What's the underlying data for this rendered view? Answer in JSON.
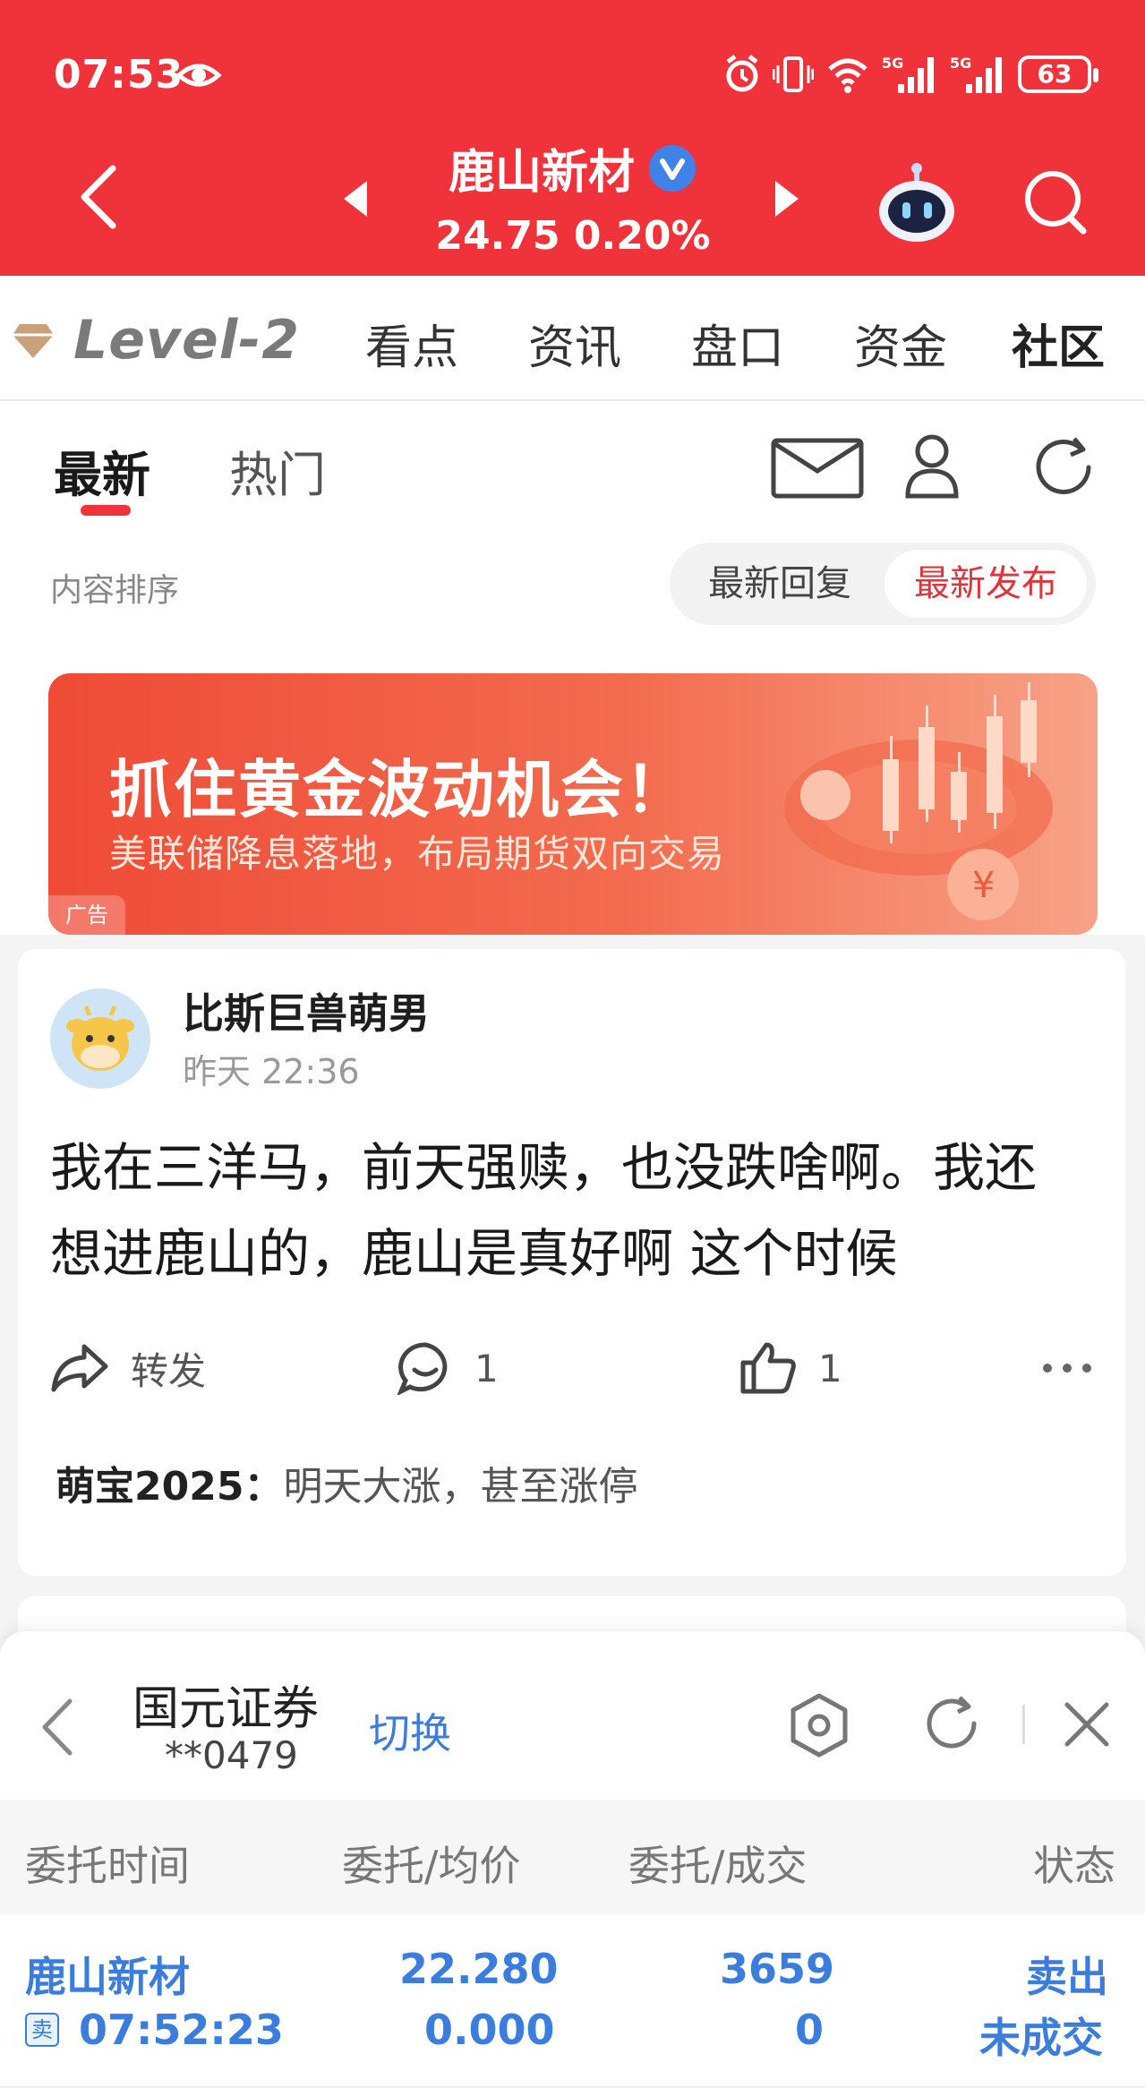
{
  "status_bar": {
    "time": "07:53",
    "battery": "63"
  },
  "header": {
    "stock_name": "鹿山新材",
    "quote": "24.75 0.20%"
  },
  "tabs": {
    "level2": "Level-2",
    "items": [
      "看点",
      "资讯",
      "盘口",
      "资金",
      "社区"
    ],
    "active": "社区"
  },
  "subtabs": {
    "items": [
      "最新",
      "热门"
    ],
    "active": "最新"
  },
  "sort": {
    "label": "内容排序",
    "options": [
      "最新回复",
      "最新发布"
    ],
    "selected": "最新发布"
  },
  "banner": {
    "title": "抓住黄金波动机会！",
    "subtitle": "美联储降息落地，布局期货双向交易",
    "ad_tag": "广告"
  },
  "post": {
    "author": "比斯巨兽萌男",
    "time": "昨天 22:36",
    "body": "我在三洋马，前天强赎，也没跌啥啊。我还想进鹿山的，鹿山是真好啊 这个时候",
    "forward_label": "转发",
    "comment_count": "1",
    "like_count": "1",
    "comment_preview": {
      "name": "萌宝2025：",
      "text": "明天大涨，甚至涨停"
    }
  },
  "trade_panel": {
    "broker": "国元证券",
    "account": "**0479",
    "switch_label": "切换",
    "columns": [
      "委托时间",
      "委托/均价",
      "委托/成交",
      "状态"
    ],
    "rows": [
      {
        "name": "鹿山新材",
        "side_tag": "卖",
        "time": "07:52:23",
        "order_price": "22.280",
        "avg_price": "0.000",
        "order_qty": "3659",
        "filled_qty": "0",
        "side": "卖出",
        "status": "未成交"
      }
    ]
  },
  "colors": {
    "brand_red": "#f0323a",
    "link_blue": "#3b7ddd"
  }
}
